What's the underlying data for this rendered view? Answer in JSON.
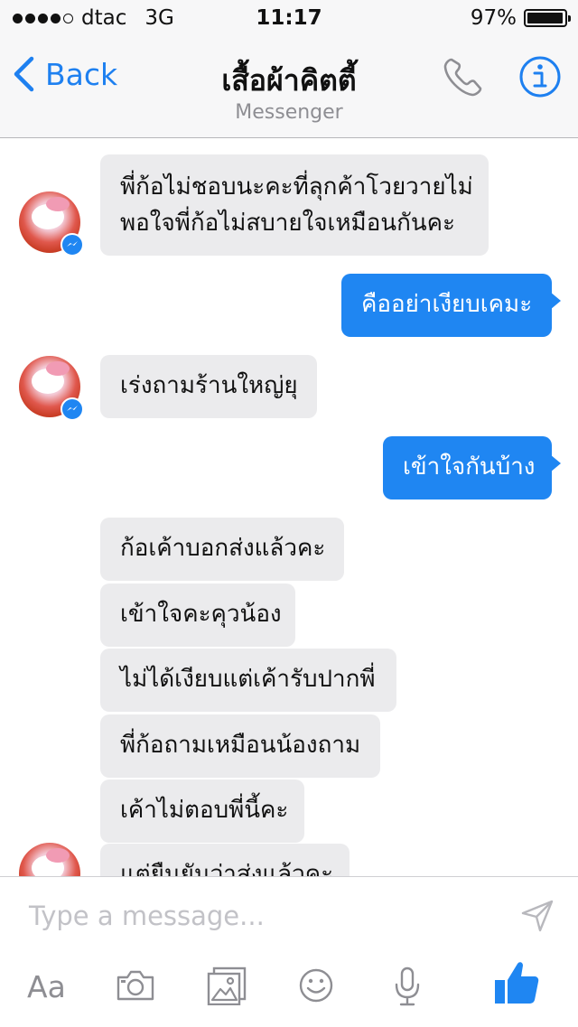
{
  "status_bar": {
    "carrier": "dtac",
    "network": "3G",
    "time": "11:17",
    "battery": "97%",
    "battery_level": 0.97,
    "signal_bars": 4
  },
  "nav": {
    "back_label": "Back",
    "title": "เสื้อผ้าคิตตี้",
    "subtitle": "Messenger"
  },
  "messages": [
    {
      "direction": "in",
      "lines": [
        "พี่ก้อไม่ชอบนะคะที่ลุกค้าโวยวายไม่",
        "พอใจพี่ก้อไม่สบายใจเหมือนกันคะ"
      ]
    },
    {
      "direction": "out",
      "lines": [
        "คืออย่าเงียบเคมะ"
      ]
    },
    {
      "direction": "in",
      "lines": [
        "เร่งถามร้านใหญ่ยุ"
      ]
    },
    {
      "direction": "out",
      "lines": [
        "เข้าใจกันบ้าง"
      ]
    },
    {
      "direction": "in",
      "lines": [
        "ก้อเค้าบอกส่งแล้วคะ"
      ]
    },
    {
      "direction": "in",
      "lines": [
        "เข้าใจคะคุวน้อง"
      ]
    },
    {
      "direction": "in",
      "lines": [
        "ไม่ได้เงียบแต่เค้ารับปากพี่"
      ]
    },
    {
      "direction": "in",
      "lines": [
        "พี่ก้อถามเหมือนน้องถาม"
      ]
    },
    {
      "direction": "in",
      "lines": [
        "เค้าไม่ตอบพี่นี้คะ"
      ]
    },
    {
      "direction": "in",
      "lines": [
        "แต่ยืนยันว่าส่งแล้วคะ"
      ]
    }
  ],
  "avatar": {
    "caption": "Happy kitty / เสื้อผ้าคิตตี้"
  },
  "composer": {
    "placeholder": "Type a message...",
    "aa_label": "Aa"
  },
  "colors": {
    "accent": "#1f86f2",
    "incoming_bubble": "#ebebed",
    "icon_gray": "#8e8e93"
  }
}
